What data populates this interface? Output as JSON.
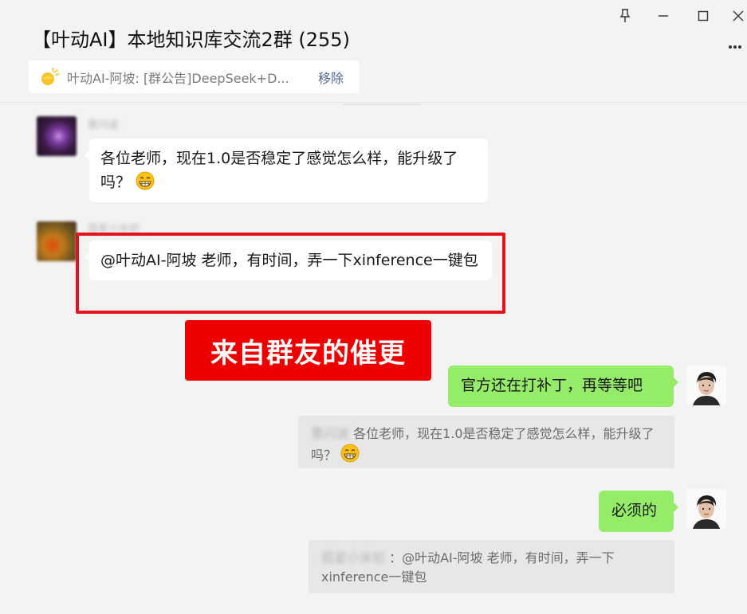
{
  "window": {
    "title": "【叶动AI】本地知识库交流2群 (255)",
    "controls": {
      "pin": "pin-icon",
      "minimize": "minimize-icon",
      "maximize": "maximize-icon",
      "close": "close-icon",
      "more": "more-icon"
    }
  },
  "notice": {
    "text": "叶动AI-阿坡: [群公告]DeepSeek+D...",
    "remove_label": "移除"
  },
  "messages": [
    {
      "side": "left",
      "sender": "曹闪波",
      "text": "各位老师，现在1.0是否稳定了感觉怎么样，能升级了吗？",
      "emoji": "grin-emoji"
    },
    {
      "side": "left",
      "sender": "孤星小米初",
      "text": "@叶动AI-阿坡 老师，有时间，弄一下xinference一键包"
    },
    {
      "side": "right",
      "text": "官方还在打补丁，再等等吧",
      "quote": {
        "sender": "曹闪波",
        "text": "各位老师，现在1.0是否稳定了感觉怎么样，能升级了吗？",
        "emoji": "grin-emoji"
      }
    },
    {
      "side": "right",
      "text": "必须的",
      "quote": {
        "sender": "孤星小米初",
        "text": "：@叶动AI-阿坡 老师，有时间，弄一下xinference一键包"
      }
    }
  ],
  "annotation": {
    "banner_text": "来自群友的催更",
    "color": "#ee0000"
  },
  "colors": {
    "background": "#f3f3f3",
    "my_bubble": "#95ec69",
    "link": "#576b95",
    "highlight": "#e1141e"
  }
}
